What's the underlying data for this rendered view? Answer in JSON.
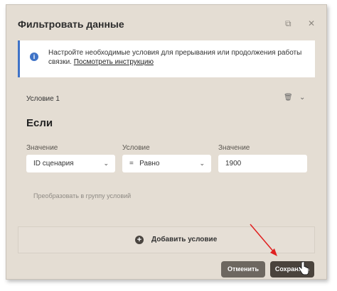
{
  "dialog": {
    "title": "Фильтровать данные",
    "header_icons": [
      "clone-icon",
      "close-icon"
    ]
  },
  "info": {
    "text": "Настройте необходимые условия для прерывания или продолжения работы связки.",
    "link": "Посмотреть инструкцию"
  },
  "condition": {
    "label": "Условие 1",
    "heading": "Если",
    "fields": [
      {
        "label": "Значение",
        "value": "ID сценария",
        "type": "select"
      },
      {
        "label": "Условие",
        "value": "=   Равно",
        "type": "select"
      },
      {
        "label": "Значение",
        "value": "1900",
        "type": "input"
      }
    ],
    "convert_link": "Преобразовать в группу условий"
  },
  "add_condition": {
    "label": "Добавить условие"
  },
  "buttons": {
    "cancel": "Отменить",
    "save": "Сохранить"
  },
  "colors": {
    "accent": "#3f73c7",
    "background": "#e4ddd3",
    "annotation_arrow": "#e02020"
  }
}
